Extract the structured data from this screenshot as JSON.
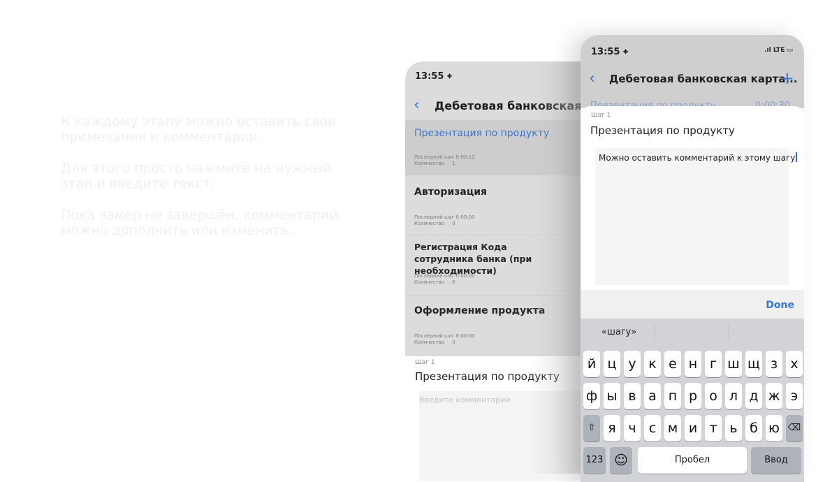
{
  "description": {
    "paragraphs": [
      "К каждому этапу можно оставить свои примечания и комментарии.",
      "Для этого просто нажмите на нужный этап и введите текст.",
      "Пока замер не завершён, комментарий можно дополнить или изменить."
    ]
  },
  "back_phone": {
    "time": "13:55 ⌖",
    "nav_title": "Дебетовая банковская карта...",
    "steps": [
      {
        "title": "Презентация по продукту",
        "last_step_label": "Последний шаг",
        "last_step_value": "0:00:12",
        "count_label": "Количество",
        "count_value": "1"
      },
      {
        "title": "Авторизация",
        "last_step_label": "Последний шаг",
        "last_step_value": "0:00:00",
        "count_label": "Количество",
        "count_value": "0"
      },
      {
        "title": "Регистрация Кода сотрудника банка (при необходимости)",
        "last_step_label": "Последний шаг",
        "last_step_value": "0:00:00",
        "count_label": "Количество",
        "count_value": "0"
      },
      {
        "title": "Оформление продукта",
        "last_step_label": "Последний шаг",
        "last_step_value": "0:00:00",
        "count_label": "Количество",
        "count_value": "0"
      }
    ],
    "sheet": {
      "step_label": "Шаг 1",
      "step_title": "Презентация по продукту",
      "placeholder": "Введите комментарий"
    }
  },
  "front_phone": {
    "time": "13:55 ⌖",
    "signal": ".ıl LTE ▭",
    "nav_title": "Дебетовая банковская карта...",
    "plus": "+",
    "peek_title": "Презентация по продукту",
    "peek_time": "0:00:30",
    "sheet": {
      "step_label": "Шаг 1",
      "step_title": "Презентация по продукту",
      "comment": "Можно оставить комментарий к этому шагу"
    },
    "done_label": "Done",
    "keyboard": {
      "suggestion": "«шагу»",
      "row1": [
        "й",
        "ц",
        "у",
        "к",
        "е",
        "н",
        "г",
        "ш",
        "щ",
        "з",
        "х"
      ],
      "row2": [
        "ф",
        "ы",
        "в",
        "а",
        "п",
        "р",
        "о",
        "л",
        "д",
        "ж",
        "э"
      ],
      "row3": [
        "я",
        "ч",
        "с",
        "м",
        "и",
        "т",
        "ь",
        "б",
        "ю"
      ],
      "shift": "⇧",
      "backspace": "⌫",
      "numbers": "123",
      "emoji": "☺",
      "space": "Пробел",
      "enter": "Ввод"
    }
  },
  "colors": {
    "accent": "#3a74d0",
    "description_text": "#f0f0f0",
    "keyboard_bg": "#d2d3d7"
  }
}
